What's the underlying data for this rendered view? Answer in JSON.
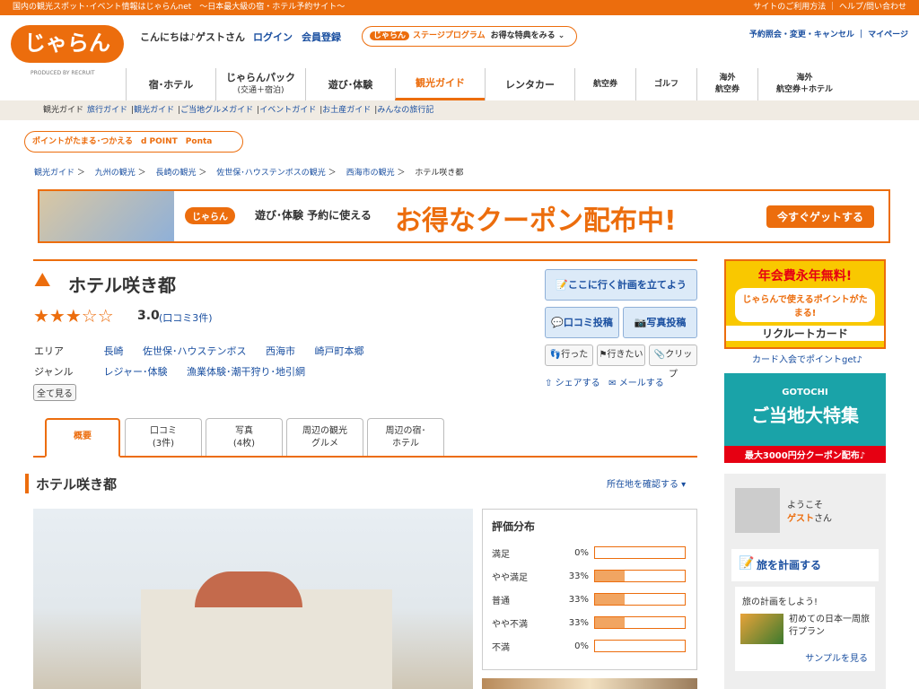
{
  "topbar": {
    "left_text": "国内の観光スポット･イベント情報はじゃらんnet　〜日本最大級の宿・ホテル予約サイト〜",
    "right_text": "サイトのご利用方法 ｜ ヘルプ/問い合わせ"
  },
  "header": {
    "logo_text": "じゃらん",
    "produced_by": "PRODUCED BY RECRUIT",
    "greeting": "こんにちは♪ゲストさん",
    "login": "ログイン",
    "register": "会員登録",
    "stage": {
      "pill": "じゃらん",
      "program": "ステージプログラム",
      "text": "お得な特典をみる"
    },
    "links": "予約照会・変更・キャンセル ｜ マイページ"
  },
  "nav": {
    "items": [
      {
        "label": "宿･ホテル"
      },
      {
        "label": "じゃらんパック",
        "sub": "(交通＋宿泊)"
      },
      {
        "label": "遊び･体験"
      },
      {
        "label": "観光ガイド"
      },
      {
        "label": "レンタカー"
      },
      {
        "label": "航空券"
      },
      {
        "label": "ゴルフ"
      },
      {
        "label": "海外",
        "sub": "航空券"
      },
      {
        "label": "海外",
        "sub": "航空券＋ホテル"
      }
    ]
  },
  "subnav": [
    "観光ガイド",
    "旅行ガイド",
    "観光ガイド",
    "ご当地グルメガイド",
    "イベントガイド",
    "お土産ガイド",
    "みんなの旅行記"
  ],
  "points_banner": "ポイントがたまる･つかえる　d POINT　Ponta",
  "breadcrumb": [
    "観光ガイド",
    "九州の観光",
    "長崎の観光",
    "佐世保･ハウステンボスの観光",
    "西海市の観光",
    "ホテル咲き都"
  ],
  "coupon_banner": {
    "pill": "じゃらん",
    "text": "遊び･体験 予約に使える",
    "big": "お得なクーポン配布中!",
    "button": "今すぐゲットする"
  },
  "spot": {
    "title": "ホテル咲き都",
    "stars": "★★★☆☆",
    "score": "3.0",
    "reviews_link": "(口コミ3件)",
    "area_label": "エリア",
    "areas": [
      "長崎",
      "佐世保･ハウステンボス",
      "西海市",
      "崎戸町本郷"
    ],
    "genre_label": "ジャンル",
    "genres": [
      "レジャー･体験",
      "漁業体験･潮干狩り･地引網"
    ],
    "show_all": "全て見る"
  },
  "actions": {
    "plan": "ここに行く計画を立てよう",
    "review": "口コミ投稿",
    "photo": "写真投稿",
    "went": "行った",
    "want": "行きたい",
    "clip": "クリップ",
    "share": "シェアする",
    "mail": "メールする"
  },
  "tabs": [
    {
      "label": "概要",
      "sub": ""
    },
    {
      "label": "口コミ",
      "sub": "(3件)"
    },
    {
      "label": "写真",
      "sub": "(4枚)"
    },
    {
      "label": "周辺の観光",
      "sub": "グルメ"
    },
    {
      "label": "周辺の宿･",
      "sub": "ホテル"
    }
  ],
  "section": {
    "title": "ホテル咲き都",
    "locate": "所在地を確認する"
  },
  "rating": {
    "title": "評価分布",
    "rows": [
      {
        "label": "満足",
        "pct": "0%",
        "value": 0
      },
      {
        "label": "やや満足",
        "pct": "33%",
        "value": 33
      },
      {
        "label": "普通",
        "pct": "33%",
        "value": 33
      },
      {
        "label": "やや不満",
        "pct": "33%",
        "value": 33
      },
      {
        "label": "不満",
        "pct": "0%",
        "value": 0
      }
    ]
  },
  "sidebar": {
    "card": {
      "t1": "年会費永年無料!",
      "mid": "じゃらんで使えるポイントがたまる!",
      "t2": "リクルートカード"
    },
    "card_link": "カード入会でポイントget♪",
    "gotochi": {
      "t1": "GOTOCHI",
      "t2": "ご当地大特集",
      "t3": "最大3000円分クーポン配布♪"
    },
    "welcome": "ようこそ",
    "guest": "ゲスト",
    "san": "さん",
    "plan_title": "旅を計画する",
    "plan_box": {
      "heading": "旅の計画をしよう!",
      "text": "初めての日本一周旅行プラン",
      "sample": "サンプルを見る"
    }
  }
}
